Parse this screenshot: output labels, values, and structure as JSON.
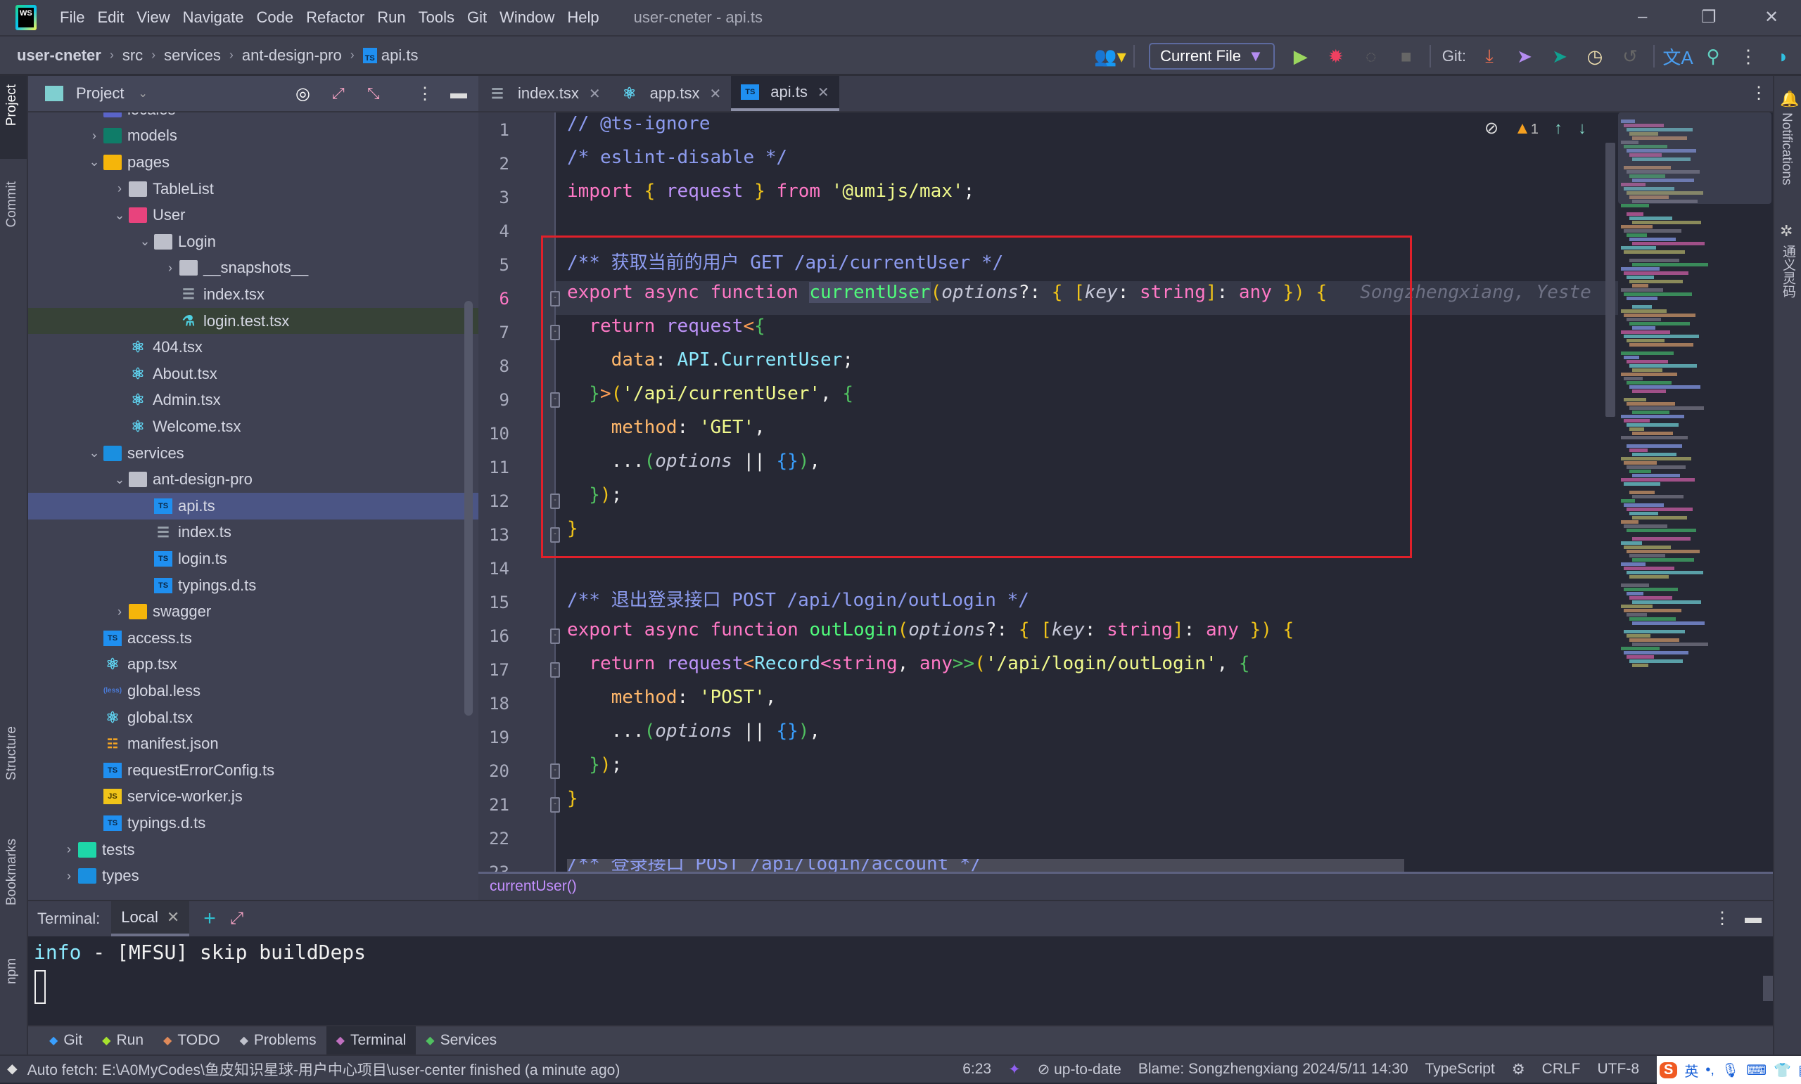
{
  "app": {
    "menu": [
      "File",
      "Edit",
      "View",
      "Navigate",
      "Code",
      "Refactor",
      "Run",
      "Tools",
      "Git",
      "Window",
      "Help"
    ],
    "window_title": "user-cneter - api.ts",
    "logo_text": "WS"
  },
  "breadcrumb": [
    "user-cneter",
    "src",
    "services",
    "ant-design-pro",
    "api.ts"
  ],
  "toolbar": {
    "run_config": "Current File",
    "git_label": "Git:"
  },
  "left_stripe": [
    "Project",
    "Commit",
    "Structure",
    "Bookmarks",
    "npm"
  ],
  "right_stripe": [
    "Notifications",
    "通义灵码"
  ],
  "project": {
    "title": "Project",
    "tree": [
      {
        "label": "locales",
        "depth": 1,
        "arrow": "closed",
        "icon": "folder-indigo"
      },
      {
        "label": "models",
        "depth": 1,
        "arrow": "closed",
        "icon": "folder-teal"
      },
      {
        "label": "pages",
        "depth": 1,
        "arrow": "open",
        "icon": "folder-yellow"
      },
      {
        "label": "TableList",
        "depth": 2,
        "arrow": "closed",
        "icon": "folder"
      },
      {
        "label": "User",
        "depth": 2,
        "arrow": "open",
        "icon": "folder-pink"
      },
      {
        "label": "Login",
        "depth": 3,
        "arrow": "open",
        "icon": "folder"
      },
      {
        "label": "__snapshots__",
        "depth": 4,
        "arrow": "closed",
        "icon": "folder"
      },
      {
        "label": "index.tsx",
        "depth": 4,
        "arrow": "",
        "icon": "index"
      },
      {
        "label": "login.test.tsx",
        "depth": 4,
        "arrow": "",
        "icon": "test",
        "state": "highlighted"
      },
      {
        "label": "404.tsx",
        "depth": 2,
        "arrow": "",
        "icon": "react"
      },
      {
        "label": "About.tsx",
        "depth": 2,
        "arrow": "",
        "icon": "react"
      },
      {
        "label": "Admin.tsx",
        "depth": 2,
        "arrow": "",
        "icon": "react"
      },
      {
        "label": "Welcome.tsx",
        "depth": 2,
        "arrow": "",
        "icon": "react"
      },
      {
        "label": "services",
        "depth": 1,
        "arrow": "open",
        "icon": "folder-blue"
      },
      {
        "label": "ant-design-pro",
        "depth": 2,
        "arrow": "open",
        "icon": "folder"
      },
      {
        "label": "api.ts",
        "depth": 3,
        "arrow": "",
        "icon": "ts",
        "state": "selected"
      },
      {
        "label": "index.ts",
        "depth": 3,
        "arrow": "",
        "icon": "index"
      },
      {
        "label": "login.ts",
        "depth": 3,
        "arrow": "",
        "icon": "ts"
      },
      {
        "label": "typings.d.ts",
        "depth": 3,
        "arrow": "",
        "icon": "ts"
      },
      {
        "label": "swagger",
        "depth": 2,
        "arrow": "closed",
        "icon": "folder-yellow"
      },
      {
        "label": "access.ts",
        "depth": 1,
        "arrow": "",
        "icon": "ts"
      },
      {
        "label": "app.tsx",
        "depth": 1,
        "arrow": "",
        "icon": "react"
      },
      {
        "label": "global.less",
        "depth": 1,
        "arrow": "",
        "icon": "less"
      },
      {
        "label": "global.tsx",
        "depth": 1,
        "arrow": "",
        "icon": "react"
      },
      {
        "label": "manifest.json",
        "depth": 1,
        "arrow": "",
        "icon": "json"
      },
      {
        "label": "requestErrorConfig.ts",
        "depth": 1,
        "arrow": "",
        "icon": "ts"
      },
      {
        "label": "service-worker.js",
        "depth": 1,
        "arrow": "",
        "icon": "js"
      },
      {
        "label": "typings.d.ts",
        "depth": 1,
        "arrow": "",
        "icon": "ts"
      },
      {
        "label": "tests",
        "depth": 0,
        "arrow": "closed",
        "icon": "folder-green"
      },
      {
        "label": "types",
        "depth": 0,
        "arrow": "closed",
        "icon": "folder-blue"
      }
    ]
  },
  "editor": {
    "tabs": [
      {
        "label": "index.tsx",
        "icon": "index"
      },
      {
        "label": "app.tsx",
        "icon": "react"
      },
      {
        "label": "api.ts",
        "icon": "ts",
        "active": true
      }
    ],
    "warning_count": "1",
    "current_line": 6,
    "lines": [
      [
        [
          "// @ts-ignore",
          "cm"
        ]
      ],
      [
        [
          "/* eslint-disable */",
          "cm"
        ]
      ],
      [
        [
          "import",
          "kw"
        ],
        [
          " { ",
          "br"
        ],
        [
          "request",
          "rq"
        ],
        [
          " } ",
          "br"
        ],
        [
          "from",
          "kw"
        ],
        [
          " '@umijs/max'",
          "st"
        ],
        [
          ";",
          "pl"
        ]
      ],
      [],
      [
        [
          "/** 获取当前的用户 GET /api/currentUser */",
          "cm"
        ]
      ],
      [
        [
          "export async function ",
          "kw"
        ],
        [
          "currentUser",
          "fnh"
        ],
        [
          "(",
          "br"
        ],
        [
          "options",
          "pa"
        ],
        [
          "?: ",
          "pl"
        ],
        [
          "{ [",
          "br"
        ],
        [
          "key",
          "pa"
        ],
        [
          ": ",
          "pl"
        ],
        [
          "string",
          "kw"
        ],
        [
          "]",
          "br"
        ],
        [
          ": ",
          "pl"
        ],
        [
          "any",
          "kw"
        ],
        [
          " }) {",
          "br"
        ],
        [
          "   Songzhengxiang, Yeste",
          "hint"
        ]
      ],
      [
        [
          "  return ",
          "kw"
        ],
        [
          "request",
          "rq"
        ],
        [
          "<",
          "op"
        ],
        [
          "{",
          "bg"
        ]
      ],
      [
        [
          "    data",
          "pr"
        ],
        [
          ": ",
          "pl"
        ],
        [
          "API",
          "ty"
        ],
        [
          ".",
          "pl"
        ],
        [
          "CurrentUser",
          "ty"
        ],
        [
          ";",
          "pl"
        ]
      ],
      [
        [
          "  }",
          "bg"
        ],
        [
          ">",
          "op"
        ],
        [
          "(",
          "br"
        ],
        [
          "'/api/currentUser'",
          "st"
        ],
        [
          ", ",
          "pl"
        ],
        [
          "{",
          "bg"
        ]
      ],
      [
        [
          "    method",
          "pr"
        ],
        [
          ": ",
          "pl"
        ],
        [
          "'GET'",
          "st"
        ],
        [
          ",",
          "pl"
        ]
      ],
      [
        [
          "    ...",
          "pl"
        ],
        [
          "(",
          "bg"
        ],
        [
          "options",
          "pa"
        ],
        [
          " || ",
          "pl"
        ],
        [
          "{}",
          "bb"
        ],
        [
          ")",
          "bg"
        ],
        [
          ",",
          "pl"
        ]
      ],
      [
        [
          "  }",
          "bg"
        ],
        [
          ")",
          "br"
        ],
        [
          ";",
          "pl"
        ]
      ],
      [
        [
          "}",
          "br"
        ]
      ],
      [],
      [
        [
          "/** 退出登录接口 POST /api/login/outLogin */",
          "cm"
        ]
      ],
      [
        [
          "export async function ",
          "kw"
        ],
        [
          "outLogin",
          "fn"
        ],
        [
          "(",
          "br"
        ],
        [
          "options",
          "pa"
        ],
        [
          "?: ",
          "pl"
        ],
        [
          "{ [",
          "br"
        ],
        [
          "key",
          "pa"
        ],
        [
          ": ",
          "pl"
        ],
        [
          "string",
          "kw"
        ],
        [
          "]",
          "br"
        ],
        [
          ": ",
          "pl"
        ],
        [
          "any",
          "kw"
        ],
        [
          " }) {",
          "br"
        ]
      ],
      [
        [
          "  return ",
          "kw"
        ],
        [
          "request",
          "rq"
        ],
        [
          "<",
          "op"
        ],
        [
          "Record",
          "ty"
        ],
        [
          "<",
          "kw"
        ],
        [
          "string",
          "kw"
        ],
        [
          ", ",
          "pl"
        ],
        [
          "any",
          "kw"
        ],
        [
          ">>",
          "bg"
        ],
        [
          "(",
          "br"
        ],
        [
          "'/api/login/outLogin'",
          "st"
        ],
        [
          ", ",
          "pl"
        ],
        [
          "{",
          "bg"
        ]
      ],
      [
        [
          "    method",
          "pr"
        ],
        [
          ": ",
          "pl"
        ],
        [
          "'POST'",
          "st"
        ],
        [
          ",",
          "pl"
        ]
      ],
      [
        [
          "    ...",
          "pl"
        ],
        [
          "(",
          "bg"
        ],
        [
          "options",
          "pa"
        ],
        [
          " || ",
          "pl"
        ],
        [
          "{}",
          "bb"
        ],
        [
          ")",
          "bg"
        ],
        [
          ",",
          "pl"
        ]
      ],
      [
        [
          "  }",
          "bg"
        ],
        [
          ")",
          "br"
        ],
        [
          ";",
          "pl"
        ]
      ],
      [
        [
          "}",
          "br"
        ]
      ],
      [],
      [
        [
          "/** 登录接口 POST /api/login/account */",
          "cm"
        ]
      ]
    ],
    "fold_lines": [
      6,
      7,
      9,
      12,
      13,
      16,
      17,
      20,
      21
    ],
    "breadcrumb": "currentUser()"
  },
  "terminal": {
    "title": "Terminal:",
    "tab": "Local",
    "lines": [
      {
        "prefix": "info",
        "text": "  - [MFSU] skip buildDeps"
      }
    ]
  },
  "tool_windows": [
    {
      "label": "Git",
      "icon": "git-icon",
      "color": "#3aa0ff"
    },
    {
      "label": "Run",
      "icon": "run-icon",
      "color": "#a6e22e"
    },
    {
      "label": "TODO",
      "icon": "todo-icon",
      "color": "#e08a5a"
    },
    {
      "label": "Problems",
      "icon": "problems-icon",
      "color": "#c0c2cc"
    },
    {
      "label": "Terminal",
      "icon": "terminal-icon",
      "color": "#c070c0",
      "active": true
    },
    {
      "label": "Services",
      "icon": "services-icon",
      "color": "#50c060"
    }
  ],
  "status": {
    "message": "Auto fetch: E:\\A0MyCodes\\鱼皮知识星球-用户中心项目\\user-center finished (a minute ago)",
    "position": "6:23",
    "vcs": "up-to-date",
    "blame": "Blame: Songzhengxiang 2024/5/11 14:30",
    "language": "TypeScript",
    "line_sep": "CRLF",
    "encoding": "UTF-8",
    "ime": "英"
  }
}
